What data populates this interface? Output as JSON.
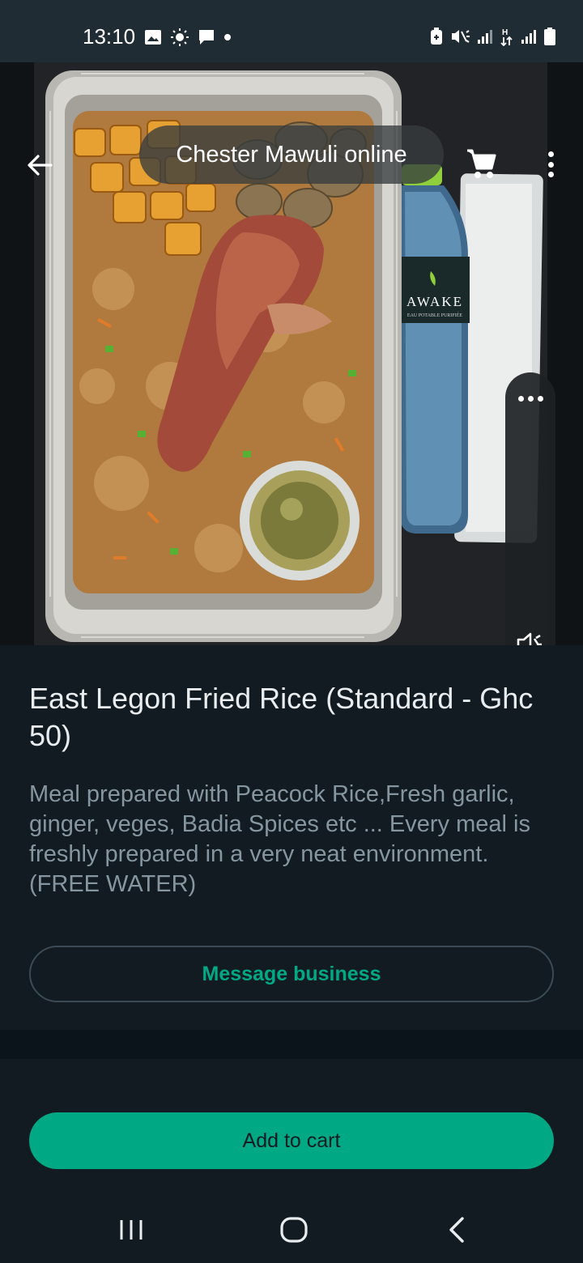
{
  "status_bar": {
    "time": "13:10",
    "left_icons": [
      "image-icon",
      "brightness-icon",
      "chat-icon",
      "dot-icon"
    ],
    "right_icons": [
      "battery-saver-icon",
      "mute-icon",
      "signal-icon",
      "data-transfer-icon",
      "signal-icon",
      "battery-icon"
    ]
  },
  "header": {
    "business_name": "Chester Mawuli online",
    "back_icon": "arrow-left-icon",
    "cart_icon": "cart-icon",
    "more_icon": "more-vert-icon"
  },
  "media": {
    "controls_more_icon": "more-horiz-icon",
    "mute_icon": "volume-mute-icon",
    "bottle_label": "AWAKE",
    "bottle_sublabel": "EAU POTABLE PURIFIÉE"
  },
  "product": {
    "title": "East Legon Fried Rice (Standard - Ghc 50)",
    "description": "Meal prepared with Peacock Rice,Fresh garlic, ginger,  veges, Badia Spices etc ... Every meal is freshly prepared in a very neat environment. (FREE WATER)"
  },
  "actions": {
    "message_label": "Message business",
    "add_to_cart_label": "Add to cart"
  },
  "nav_bar": {
    "recent_icon": "recent-apps-icon",
    "home_icon": "home-icon",
    "back_icon": "nav-back-icon"
  },
  "colors": {
    "background": "#111b21",
    "status_bar": "#1f2c34",
    "accent": "#00a884",
    "secondary_text": "#8696a0",
    "primary_text": "#e9edef"
  }
}
